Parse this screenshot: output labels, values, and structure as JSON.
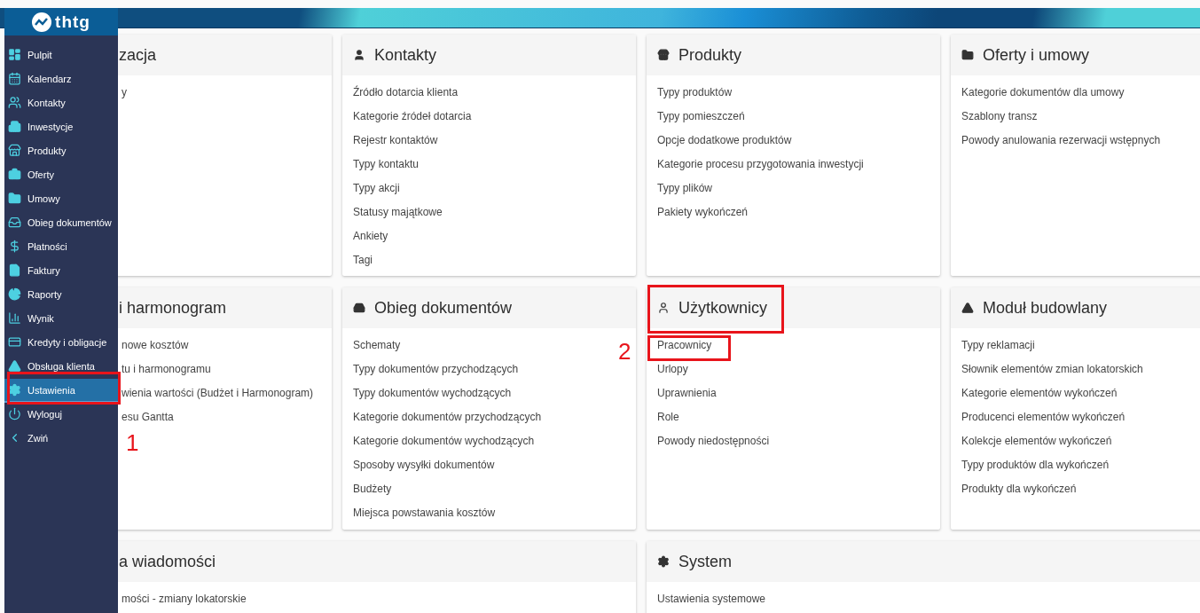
{
  "logo": "thtg",
  "sidebar": {
    "items": [
      {
        "label": "Pulpit",
        "selected": false
      },
      {
        "label": "Kalendarz",
        "selected": false
      },
      {
        "label": "Kontakty",
        "selected": false
      },
      {
        "label": "Inwestycje",
        "selected": false
      },
      {
        "label": "Produkty",
        "selected": false
      },
      {
        "label": "Oferty",
        "selected": false
      },
      {
        "label": "Umowy",
        "selected": false
      },
      {
        "label": "Obieg dokumentów",
        "selected": false
      },
      {
        "label": "Płatności",
        "selected": false
      },
      {
        "label": "Faktury",
        "selected": false
      },
      {
        "label": "Raporty",
        "selected": false
      },
      {
        "label": "Wynik",
        "selected": false
      },
      {
        "label": "Kredyty i obligacje",
        "selected": false
      },
      {
        "label": "Obsługa klienta",
        "selected": false
      },
      {
        "label": "Ustawienia",
        "selected": true
      },
      {
        "label": "Wyloguj",
        "selected": false
      },
      {
        "label": "Zwiń",
        "selected": false
      }
    ]
  },
  "cards": [
    {
      "title": "zacja",
      "items": [
        {
          "label": "y",
          "highlighted": false
        }
      ]
    },
    {
      "title": "Kontakty",
      "items": [
        {
          "label": "Źródło dotarcia klienta",
          "highlighted": false
        },
        {
          "label": "Kategorie źródeł dotarcia",
          "highlighted": false
        },
        {
          "label": "Rejestr kontaktów",
          "highlighted": false
        },
        {
          "label": "Typy kontaktu",
          "highlighted": false
        },
        {
          "label": "Typy akcji",
          "highlighted": false
        },
        {
          "label": "Statusy majątkowe",
          "highlighted": false
        },
        {
          "label": "Ankiety",
          "highlighted": false
        },
        {
          "label": "Tagi",
          "highlighted": false
        }
      ]
    },
    {
      "title": "Produkty",
      "items": [
        {
          "label": "Typy produktów",
          "highlighted": false
        },
        {
          "label": "Typy pomieszczeń",
          "highlighted": false
        },
        {
          "label": "Opcje dodatkowe produktów",
          "highlighted": false
        },
        {
          "label": "Kategorie procesu przygotowania inwestycji",
          "highlighted": false
        },
        {
          "label": "Typy plików",
          "highlighted": false
        },
        {
          "label": "Pakiety wykończeń",
          "highlighted": false
        }
      ]
    },
    {
      "title": "Oferty i umowy",
      "items": [
        {
          "label": "Kategorie dokumentów dla umowy",
          "highlighted": false
        },
        {
          "label": "Szablony transz",
          "highlighted": false
        },
        {
          "label": "Powody anulowania rezerwacji wstępnych",
          "highlighted": false
        }
      ]
    },
    {
      "title": "i harmonogram",
      "items": [
        {
          "label": "nowe kosztów",
          "highlighted": false
        },
        {
          "label": "tu i harmonogramu",
          "highlighted": false
        },
        {
          "label": "wienia wartości (Budżet i Harmonogram)",
          "highlighted": false
        },
        {
          "label": "esu Gantta",
          "highlighted": false
        }
      ]
    },
    {
      "title": "Obieg dokumentów",
      "items": [
        {
          "label": "Schematy",
          "highlighted": false
        },
        {
          "label": "Typy dokumentów przychodzących",
          "highlighted": false
        },
        {
          "label": "Typy dokumentów wychodzących",
          "highlighted": false
        },
        {
          "label": "Kategorie dokumentów przychodzących",
          "highlighted": false
        },
        {
          "label": "Kategorie dokumentów wychodzących",
          "highlighted": false
        },
        {
          "label": "Sposoby wysyłki dokumentów",
          "highlighted": false
        },
        {
          "label": "Budżety",
          "highlighted": false
        },
        {
          "label": "Miejsca powstawania kosztów",
          "highlighted": false
        }
      ]
    },
    {
      "title": "Użytkownicy",
      "items": [
        {
          "label": "Pracownicy",
          "highlighted": false
        },
        {
          "label": "Urlopy",
          "highlighted": false
        },
        {
          "label": "Uprawnienia",
          "highlighted": false
        },
        {
          "label": "Role",
          "highlighted": false
        },
        {
          "label": "Powody niedostępności",
          "highlighted": false
        }
      ]
    },
    {
      "title": "Moduł budowlany",
      "items": [
        {
          "label": "Typy reklamacji",
          "highlighted": false
        },
        {
          "label": "Słownik elementów zmian lokatorskich",
          "highlighted": false
        },
        {
          "label": "Kategorie elementów wykończeń",
          "highlighted": false
        },
        {
          "label": "Producenci elementów wykończeń",
          "highlighted": false
        },
        {
          "label": "Kolekcje elementów wykończeń",
          "highlighted": false
        },
        {
          "label": "Typy produktów dla wykończeń",
          "highlighted": false
        },
        {
          "label": "Produkty dla wykończeń",
          "highlighted": false
        }
      ]
    },
    {
      "title": "a wiadomości",
      "items": [
        {
          "label": "mości - zmiany lokatorskie",
          "highlighted": false
        }
      ]
    },
    {
      "title": "System",
      "items": [
        {
          "label": "Ustawienia systemowe",
          "highlighted": false
        }
      ]
    }
  ],
  "annotations": [
    {
      "label": "1"
    },
    {
      "label": "2"
    }
  ]
}
